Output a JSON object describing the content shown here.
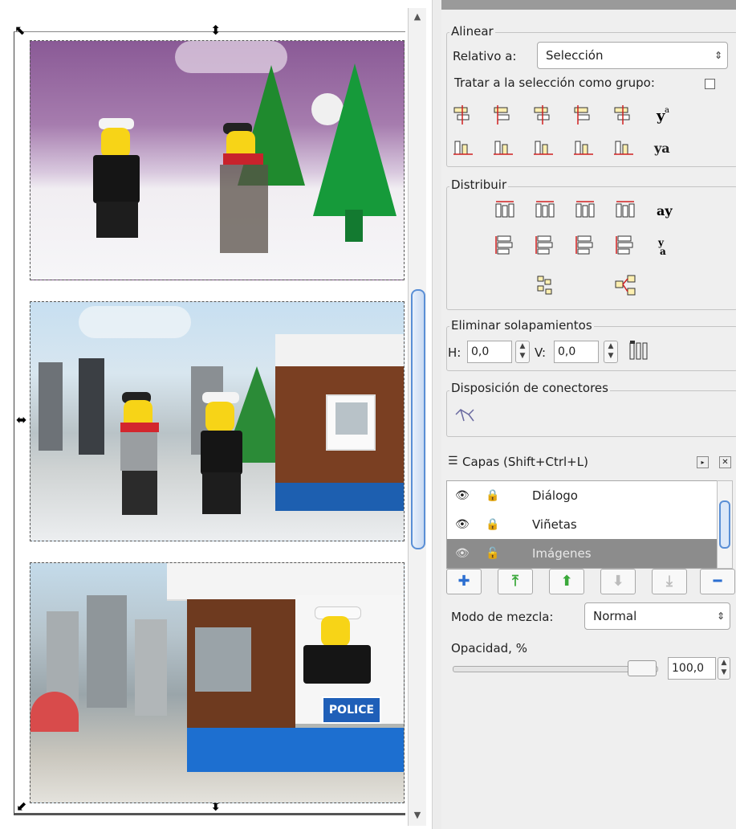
{
  "colors": {
    "accent": "#5a8fd6",
    "selected_row": "#8c8c8c",
    "panel_bg": "#efefef"
  },
  "canvas": {
    "handles": {
      "tl": "⬉",
      "top": "⬍",
      "left": "⬌",
      "bl": "⬋",
      "bottom": "⬍"
    },
    "images": [
      {
        "scene": "winter-snowball"
      },
      {
        "scene": "police-arrest"
      },
      {
        "scene": "police-booth",
        "sign_text": "POLICE"
      }
    ]
  },
  "scrollbar": {
    "up": "▲",
    "down": "▼"
  },
  "align": {
    "title": "Alinear",
    "relative_label": "Relativo a:",
    "relative_value": "Selección",
    "group_label": "Tratar a la selección como grupo:",
    "group_checked": false
  },
  "distribute": {
    "title": "Distribuir"
  },
  "overlap": {
    "title": "Eliminar solapamientos",
    "h_label": "H:",
    "h_value": "0,0",
    "v_label": "V:",
    "v_value": "0,0"
  },
  "connectors": {
    "title": "Disposición de conectores"
  },
  "layers": {
    "title": "Capas (Shift+Ctrl+L)",
    "items": [
      {
        "name": "Diálogo",
        "visible": true,
        "locked": true,
        "selected": false
      },
      {
        "name": "Viñetas",
        "visible": true,
        "locked": true,
        "selected": false
      },
      {
        "name": "Imágenes",
        "visible": true,
        "locked": false,
        "selected": true
      }
    ],
    "blend_label": "Modo de mezcla:",
    "blend_value": "Normal",
    "opacity_label": "Opacidad, %",
    "opacity_value": "100,0",
    "opacity_level": 1.0
  }
}
